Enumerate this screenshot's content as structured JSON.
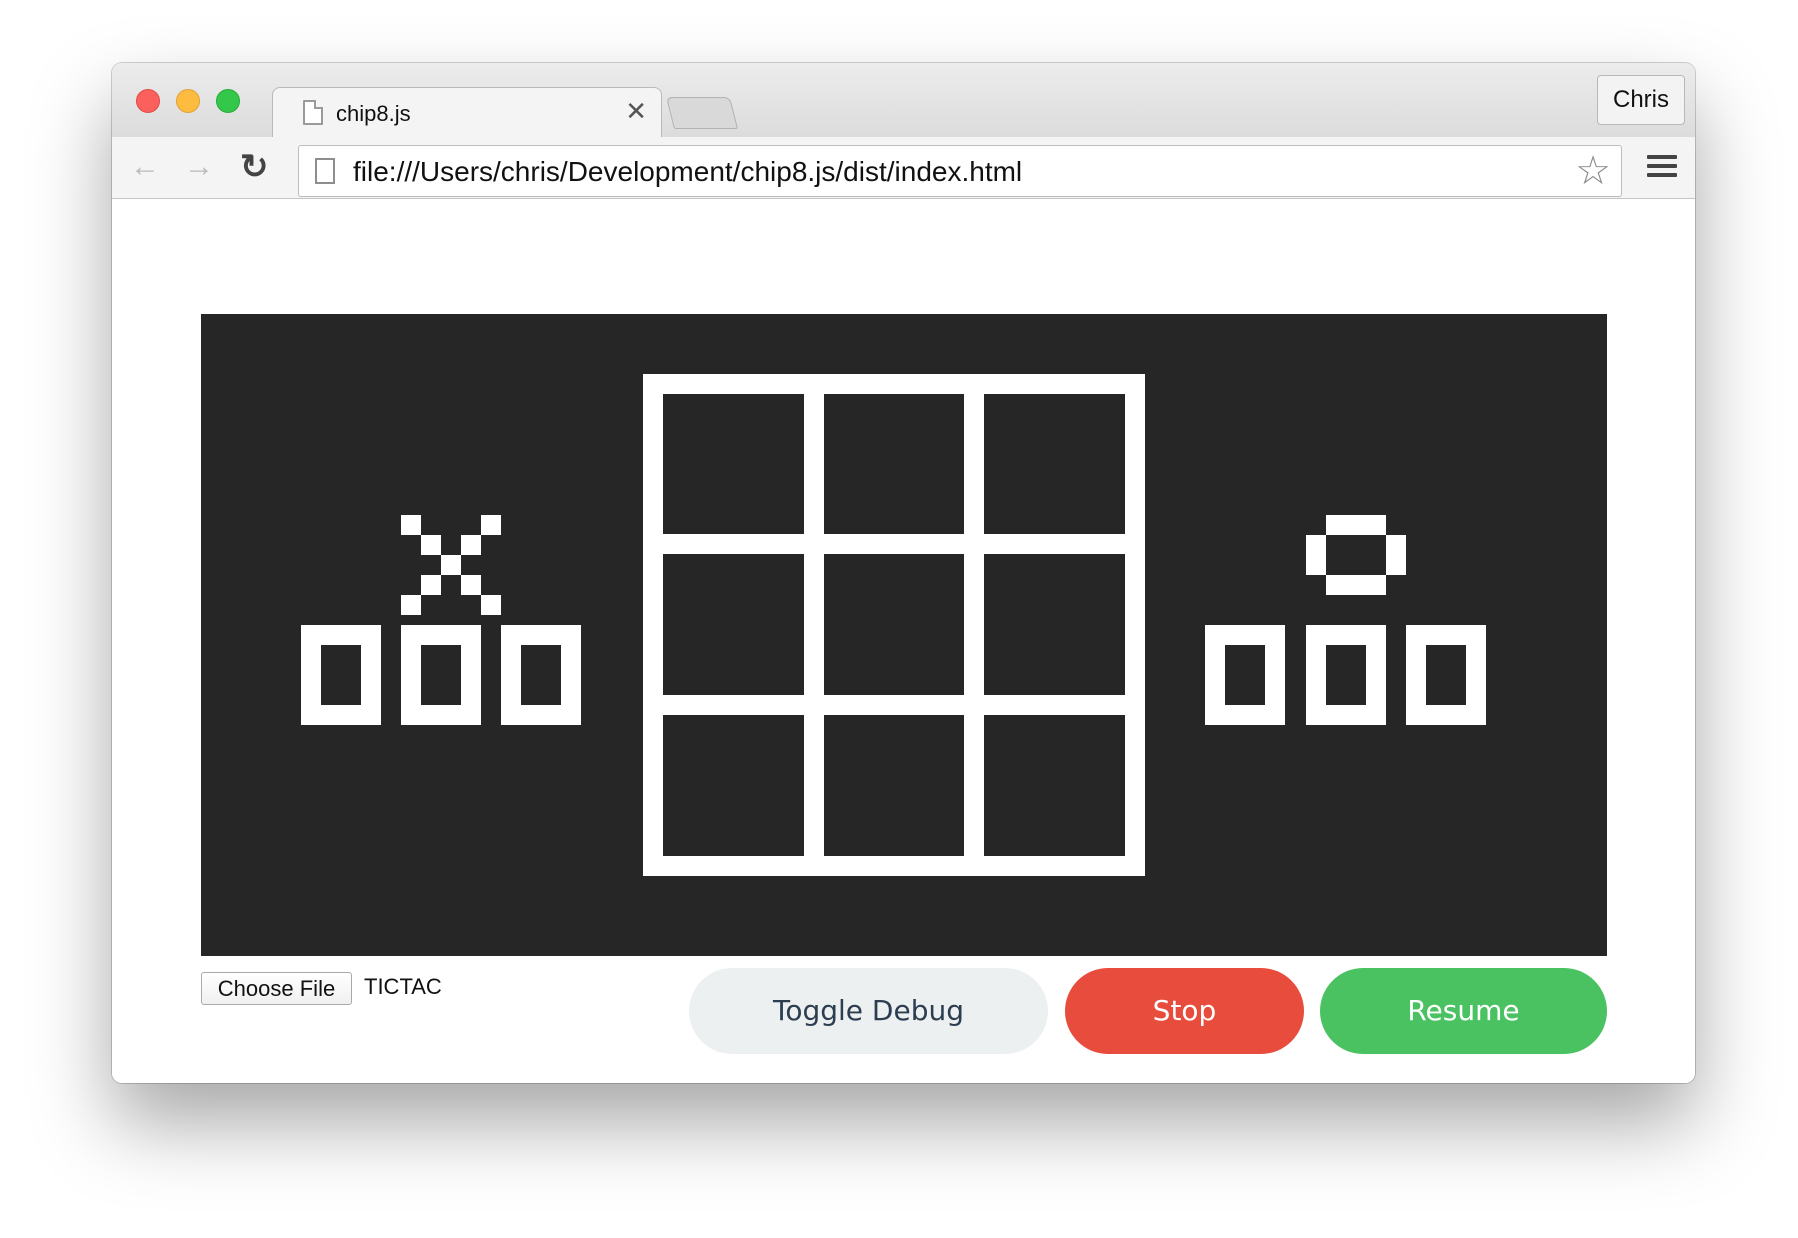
{
  "browser": {
    "tab_title": "chip8.js",
    "tab_close": "✕",
    "profile_name": "Chris",
    "url": "file:///Users/chris/Development/chip8.js/dist/index.html",
    "icons": {
      "back": "arrow-left-icon",
      "forward": "arrow-right-icon",
      "reload": "reload-icon",
      "star": "star-icon",
      "menu": "hamburger-menu-icon",
      "page": "document-icon"
    },
    "traffic_lights": {
      "close": "#fc605c",
      "minimize": "#fdbc40",
      "zoom": "#34c84a"
    }
  },
  "emulator": {
    "screen_background": "#262626",
    "pixel_color": "#ffffff",
    "game": "tic-tac-toe",
    "left_player_symbol": "X",
    "right_player_symbol": "O",
    "left_score": "000",
    "right_score": "000"
  },
  "controls": {
    "file_button": "Choose File",
    "file_name": "TICTAC",
    "toggle_debug": "Toggle Debug",
    "stop": "Stop",
    "resume": "Resume",
    "colors": {
      "debug_bg": "#ecf0f1",
      "stop_bg": "#e74c3c",
      "resume_bg": "#4ac262"
    }
  }
}
